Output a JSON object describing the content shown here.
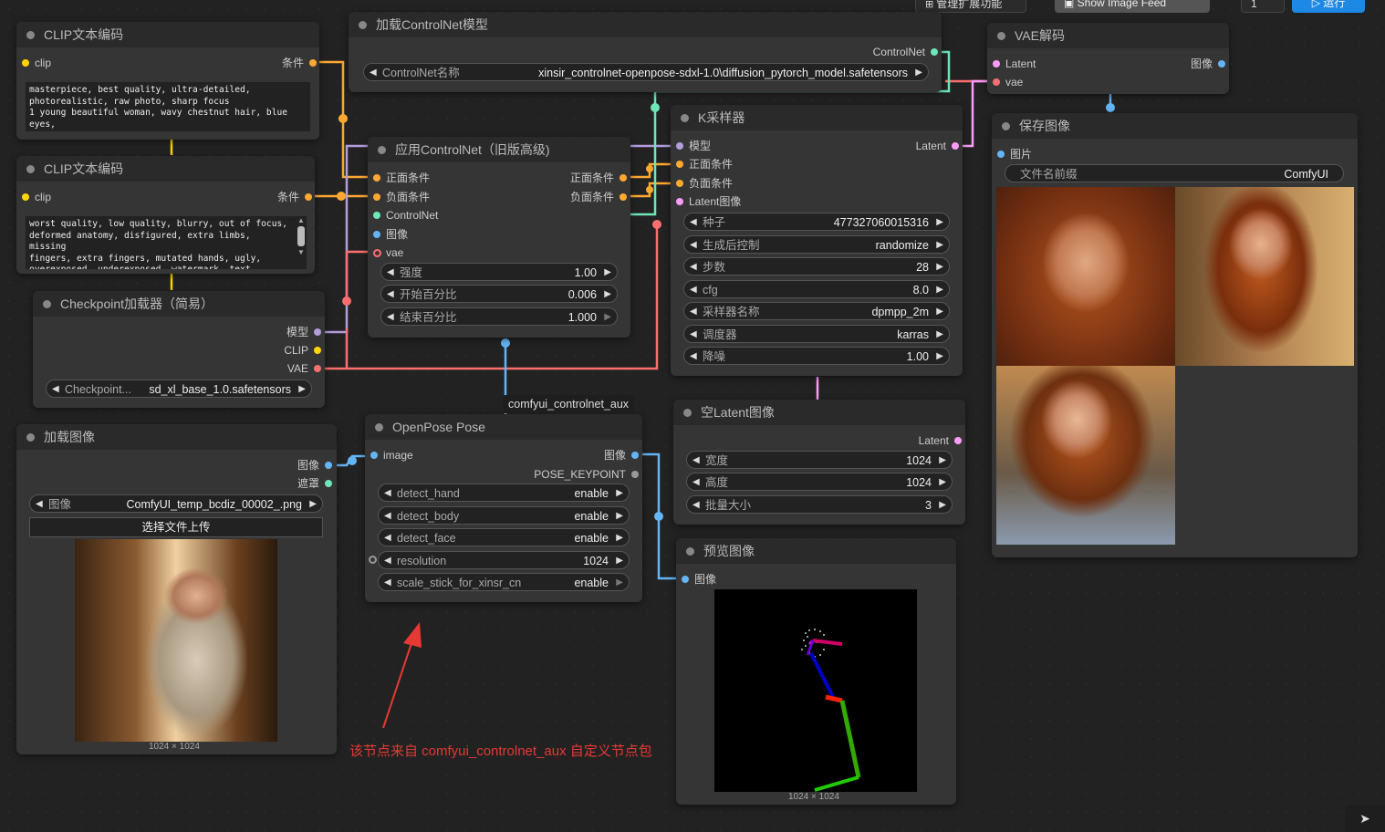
{
  "toolbar": {
    "manage_ext": "管理扩展功能",
    "image_feed": "Show Image Feed",
    "queue_count": "1",
    "run": "运行"
  },
  "nodes": {
    "clip_pos": {
      "title": "CLIP文本编码",
      "in_clip": "clip",
      "out_cond": "条件",
      "text": "masterpiece, best quality, ultra-detailed,\nphotorealistic, raw photo, sharp focus\n1 young beautiful woman, wavy chestnut hair, blue\neyes,"
    },
    "clip_neg": {
      "title": "CLIP文本编码",
      "in_clip": "clip",
      "out_cond": "条件",
      "text": "worst quality, low quality, blurry, out of focus,\ndeformed anatomy, disfigured, extra limbs, missing\nfingers, extra fingers, mutated hands, ugly,\noverexposed, underexposed, watermark, text,\nsignature, cropped, jpeg artifacts, grainy"
    },
    "checkpoint": {
      "title": "Checkpoint加载器（简易）",
      "out_model": "模型",
      "out_clip": "CLIP",
      "out_vae": "VAE",
      "w_label": "Checkpoint...",
      "w_value": "sd_xl_base_1.0.safetensors"
    },
    "load_cn": {
      "title": "加载ControlNet模型",
      "out": "ControlNet",
      "w_label": "ControlNet名称",
      "w_value": "xinsir_controlnet-openpose-sdxl-1.0\\diffusion_pytorch_model.safetensors"
    },
    "apply_cn": {
      "title": "应用ControlNet（旧版高级)",
      "in_pos": "正面条件",
      "in_neg": "负面条件",
      "in_cn": "ControlNet",
      "in_img": "图像",
      "in_vae": "vae",
      "out_pos": "正面条件",
      "out_neg": "负面条件",
      "w_strength_l": "强度",
      "w_strength_v": "1.00",
      "w_start_l": "开始百分比",
      "w_start_v": "0.006",
      "w_end_l": "结束百分比",
      "w_end_v": "1.000"
    },
    "ksampler": {
      "title": "K采样器",
      "in_model": "模型",
      "in_pos": "正面条件",
      "in_neg": "负面条件",
      "in_latent": "Latent图像",
      "out_latent": "Latent",
      "widgets": [
        {
          "l": "种子",
          "v": "477327060015316"
        },
        {
          "l": "生成后控制",
          "v": "randomize"
        },
        {
          "l": "步数",
          "v": "28"
        },
        {
          "l": "cfg",
          "v": "8.0"
        },
        {
          "l": "采样器名称",
          "v": "dpmpp_2m"
        },
        {
          "l": "调度器",
          "v": "karras"
        },
        {
          "l": "降噪",
          "v": "1.00"
        }
      ]
    },
    "vae_decode": {
      "title": "VAE解码",
      "in_latent": "Latent",
      "in_vae": "vae",
      "out_img": "图像"
    },
    "save": {
      "title": "保存图像",
      "in_img": "图片",
      "w_label": "文件名前缀",
      "w_value": "ComfyUI"
    },
    "load_image": {
      "title": "加载图像",
      "out_img": "图像",
      "out_mask": "遮罩",
      "w_label": "图像",
      "w_value": "ComfyUI_temp_bcdiz_00002_.png",
      "upload": "选择文件上传",
      "size": "1024 × 1024"
    },
    "openpose": {
      "title": "OpenPose Pose",
      "badge": "comfyui_controlnet_aux",
      "in_img": "image",
      "out_img": "图像",
      "out_kp": "POSE_KEYPOINT",
      "widgets": [
        {
          "l": "detect_hand",
          "v": "enable"
        },
        {
          "l": "detect_body",
          "v": "enable"
        },
        {
          "l": "detect_face",
          "v": "enable"
        },
        {
          "l": "resolution",
          "v": "1024"
        },
        {
          "l": "scale_stick_for_xinsr_cn",
          "v": "enable"
        }
      ]
    },
    "empty_latent": {
      "title": "空Latent图像",
      "out_latent": "Latent",
      "widgets": [
        {
          "l": "宽度",
          "v": "1024"
        },
        {
          "l": "高度",
          "v": "1024"
        },
        {
          "l": "批量大小",
          "v": "3"
        }
      ]
    },
    "preview": {
      "title": "预览图像",
      "in_img": "图像",
      "size": "1024 × 1024"
    }
  },
  "annotation": "该节点来自 comfyui_controlnet_aux 自定义节点包",
  "colors": {
    "conditioning": "#ffa931",
    "clip": "#ffd500",
    "model": "#b39ddb",
    "vae": "#ff6e6e",
    "controlnet": "#6ee7b7",
    "image": "#64b5f6",
    "latent": "#ff9cf9",
    "annotation": "#e53935"
  }
}
